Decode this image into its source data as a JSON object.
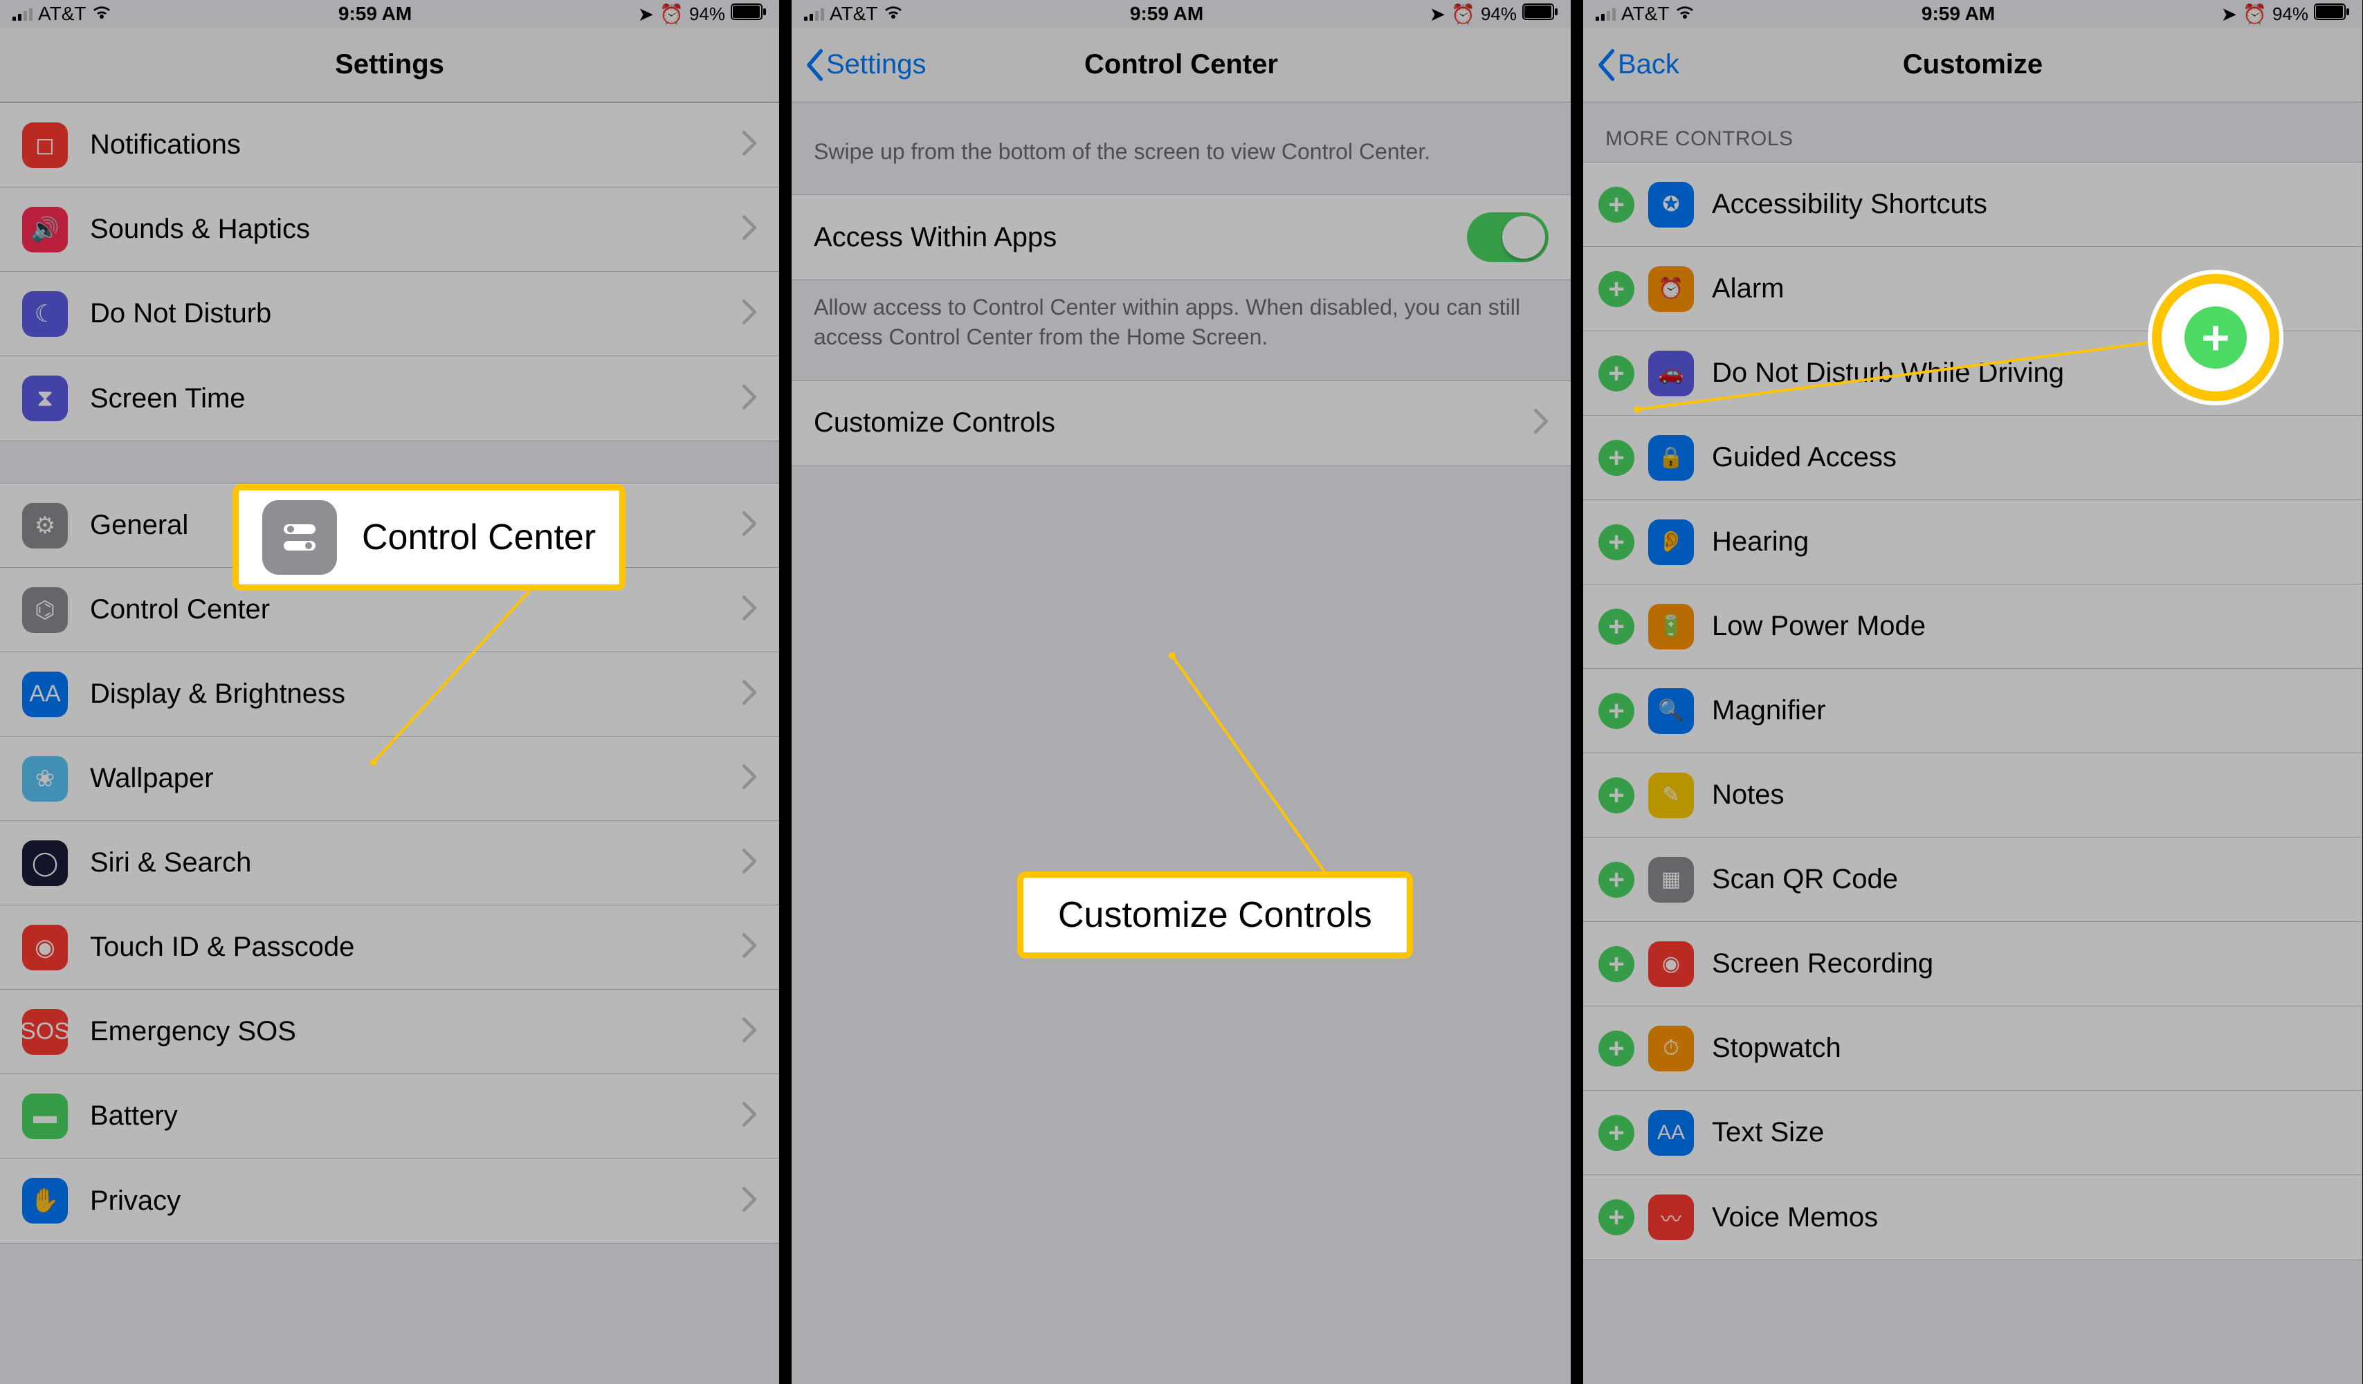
{
  "status": {
    "carrier": "AT&T",
    "time": "9:59 AM",
    "battery": "94%"
  },
  "screens": {
    "settings": {
      "title": "Settings",
      "groups": [
        [
          {
            "label": "Notifications",
            "icon": "notif",
            "bg": "#ff3b30"
          },
          {
            "label": "Sounds & Haptics",
            "icon": "sound",
            "bg": "#ff2d55"
          },
          {
            "label": "Do Not Disturb",
            "icon": "moon",
            "bg": "#5e5ce6"
          },
          {
            "label": "Screen Time",
            "icon": "hourglass",
            "bg": "#5e5ce6"
          }
        ],
        [
          {
            "label": "General",
            "icon": "gear",
            "bg": "#8e8e93"
          },
          {
            "label": "Control Center",
            "icon": "cc",
            "bg": "#8e8e93"
          },
          {
            "label": "Display & Brightness",
            "icon": "aa",
            "bg": "#007aff"
          },
          {
            "label": "Wallpaper",
            "icon": "flower",
            "bg": "#5ac8fa"
          },
          {
            "label": "Siri & Search",
            "icon": "siri",
            "bg": "#1b1b3a"
          },
          {
            "label": "Touch ID & Passcode",
            "icon": "fingerprint",
            "bg": "#ff3b30"
          },
          {
            "label": "Emergency SOS",
            "icon": "sos",
            "bg": "#ff3b30"
          },
          {
            "label": "Battery",
            "icon": "batt",
            "bg": "#4cd964"
          },
          {
            "label": "Privacy",
            "icon": "hand",
            "bg": "#007aff"
          }
        ]
      ],
      "callout": {
        "label": "Control Center"
      }
    },
    "cc": {
      "back": "Settings",
      "title": "Control Center",
      "intro": "Swipe up from the bottom of the screen to view Control Center.",
      "toggle_label": "Access Within Apps",
      "toggle_footer": "Allow access to Control Center within apps. When disabled, you can still access Control Center from the Home Screen.",
      "customize_label": "Customize Controls",
      "callout": {
        "label": "Customize Controls"
      }
    },
    "cust": {
      "back": "Back",
      "title": "Customize",
      "header": "MORE CONTROLS",
      "items": [
        {
          "label": "Accessibility Shortcuts",
          "bg": "#007aff",
          "glyph": "✪"
        },
        {
          "label": "Alarm",
          "bg": "#ff9500",
          "glyph": "⏰"
        },
        {
          "label": "Do Not Disturb While Driving",
          "bg": "#5e5ce6",
          "glyph": "🚗"
        },
        {
          "label": "Guided Access",
          "bg": "#007aff",
          "glyph": "🔒"
        },
        {
          "label": "Hearing",
          "bg": "#007aff",
          "glyph": "👂"
        },
        {
          "label": "Low Power Mode",
          "bg": "#ff9500",
          "glyph": "🔋"
        },
        {
          "label": "Magnifier",
          "bg": "#007aff",
          "glyph": "🔍"
        },
        {
          "label": "Notes",
          "bg": "#ffcc00",
          "glyph": "✎"
        },
        {
          "label": "Scan QR Code",
          "bg": "#8e8e93",
          "glyph": "▦"
        },
        {
          "label": "Screen Recording",
          "bg": "#ff3b30",
          "glyph": "◉"
        },
        {
          "label": "Stopwatch",
          "bg": "#ff9500",
          "glyph": "⏱"
        },
        {
          "label": "Text Size",
          "bg": "#007aff",
          "glyph": "AA"
        },
        {
          "label": "Voice Memos",
          "bg": "#ff3b30",
          "glyph": "〰"
        }
      ]
    }
  }
}
